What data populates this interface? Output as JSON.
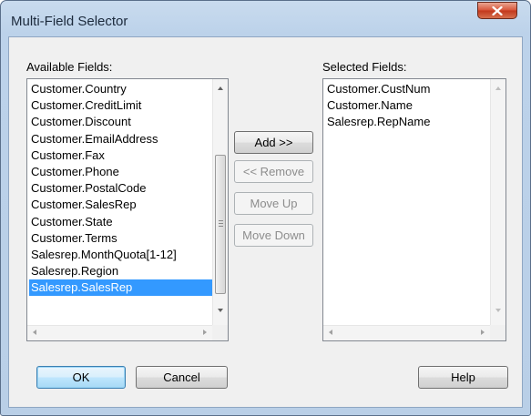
{
  "window": {
    "title": "Multi-Field Selector"
  },
  "available": {
    "label": "Available Fields:",
    "items": [
      "Customer.Country",
      "Customer.CreditLimit",
      "Customer.Discount",
      "Customer.EmailAddress",
      "Customer.Fax",
      "Customer.Phone",
      "Customer.PostalCode",
      "Customer.SalesRep",
      "Customer.State",
      "Customer.Terms",
      "Salesrep.MonthQuota[1-12]",
      "Salesrep.Region",
      "Salesrep.SalesRep"
    ],
    "selected_item": "Salesrep.SalesRep"
  },
  "selected": {
    "label": "Selected Fields:",
    "items": [
      "Customer.CustNum",
      "Customer.Name",
      "Salesrep.RepName"
    ]
  },
  "buttons": {
    "add": "Add >>",
    "remove": "<< Remove",
    "move_up": "Move Up",
    "move_down": "Move Down",
    "ok": "OK",
    "cancel": "Cancel",
    "help": "Help"
  },
  "colors": {
    "selection": "#3399ff",
    "close_button": "#c9452a",
    "title_bar": "#bcd2ea"
  }
}
